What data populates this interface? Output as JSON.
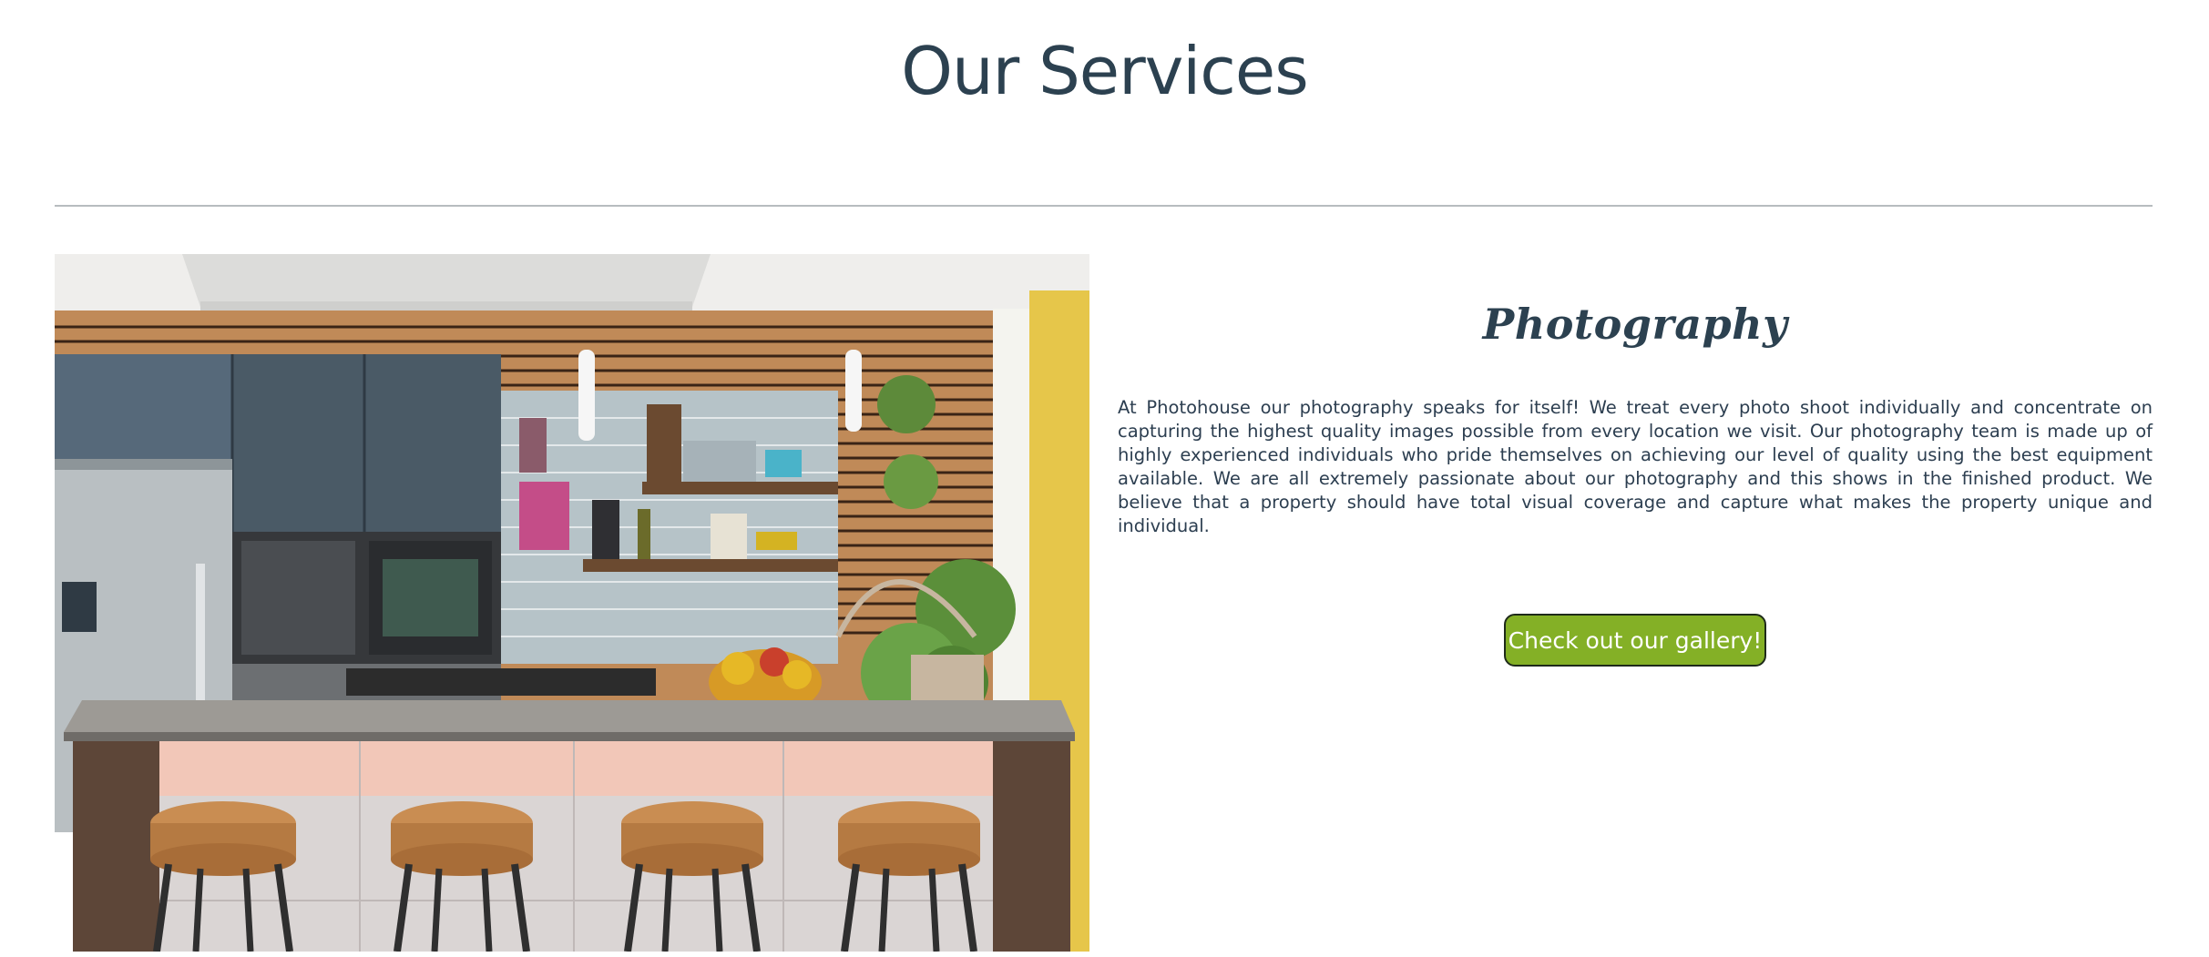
{
  "section": {
    "title": "Our Services"
  },
  "service": {
    "heading": "Photography",
    "description": "At Photohouse our photography speaks for itself! We treat every photo shoot individually and concentrate on capturing the highest quality images possible from every location we visit. Our photography team is made up of highly experienced individuals who pride themselves on achieving our level of quality using the best equipment available. We are all extremely passionate about our photography and this shows in the finished product. We believe that a property should have total visual coverage and capture what makes the property unique and individual.",
    "button_label": "Check out our gallery!",
    "image_subject": "kitchen-photo"
  },
  "colors": {
    "heading": "#2c4150",
    "text": "#2c3e50",
    "button_bg": "#84b026",
    "button_border": "#1e2a1a",
    "divider": "#b7bcbf"
  }
}
